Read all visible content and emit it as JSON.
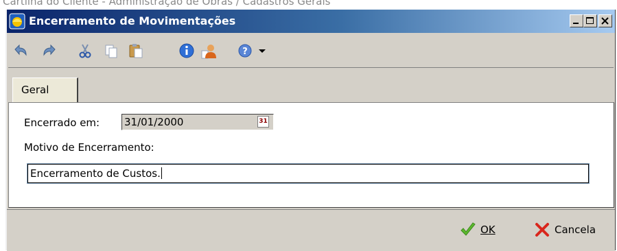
{
  "background_caption": "Cartilha do Cliente - Administração de Obras / Cadastros Gerais",
  "window": {
    "title": "Encerramento de Movimentações",
    "controls": [
      "minimize-icon",
      "maximize-icon",
      "close-icon"
    ]
  },
  "toolbar": {
    "icons": [
      "undo-icon",
      "redo-icon",
      "cut-icon",
      "copy-icon",
      "paste-icon",
      "info-icon",
      "user-icon",
      "help-icon",
      "dropdown-arrow-icon"
    ]
  },
  "tabs": [
    {
      "label": "Geral",
      "selected": true
    }
  ],
  "form": {
    "closed_on_label": "Encerrado em:",
    "closed_on_value": "31/01/2000",
    "reason_label": "Motivo de Encerramento:",
    "reason_value": "Encerramento de Custos."
  },
  "buttons": {
    "ok_label": "OK",
    "cancel_label": "Cancela"
  },
  "colors": {
    "title_bar_start": "#0a246a",
    "title_bar_end": "#a6caf0",
    "window_face": "#d4d0c8",
    "ok_check": "#5cb82e",
    "cancel_x": "#d9261c"
  }
}
